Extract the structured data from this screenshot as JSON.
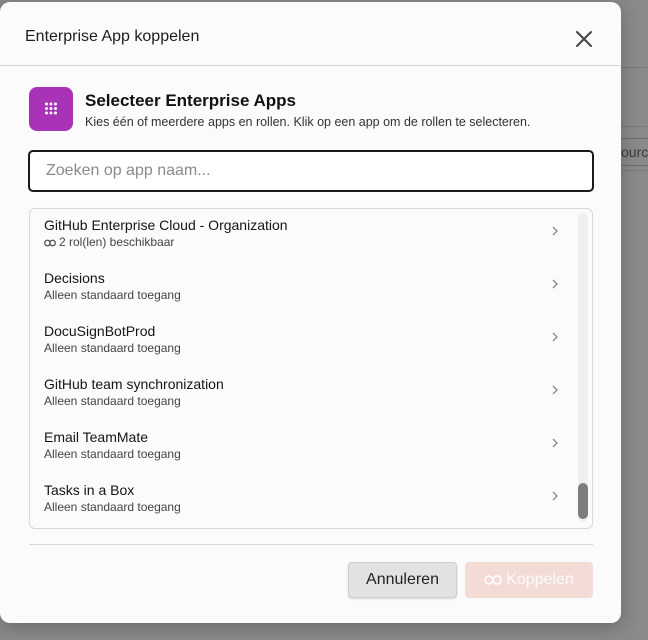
{
  "background": {
    "chip_text": "ourc"
  },
  "modal": {
    "title": "Enterprise App koppelen",
    "heading": "Selecteer Enterprise Apps",
    "subheading": "Kies één of meerdere apps en rollen. Klik op een app om de rollen te selecteren.",
    "search": {
      "placeholder": "Zoeken op app naam...",
      "value": ""
    },
    "apps": [
      {
        "name": "GitHub Enterprise Cloud - Organization",
        "subtitle": "2 rol(len) beschikbaar",
        "has_roles": true
      },
      {
        "name": "Decisions",
        "subtitle": "Alleen standaard toegang",
        "has_roles": false
      },
      {
        "name": "DocuSignBotProd",
        "subtitle": "Alleen standaard toegang",
        "has_roles": false
      },
      {
        "name": "GitHub team synchronization",
        "subtitle": "Alleen standaard toegang",
        "has_roles": false
      },
      {
        "name": "Email TeamMate",
        "subtitle": "Alleen standaard toegang",
        "has_roles": false
      },
      {
        "name": "Tasks in a Box",
        "subtitle": "Alleen standaard toegang",
        "has_roles": false
      }
    ],
    "buttons": {
      "cancel": "Annuleren",
      "link": "Koppelen"
    },
    "colors": {
      "accent": "#a933b6",
      "link_button_disabled": "#f4dcd6"
    },
    "icons": {
      "app": "grid-dots-icon",
      "close": "close-icon",
      "chevron": "chevron-right-icon",
      "roles": "link-icon"
    }
  }
}
